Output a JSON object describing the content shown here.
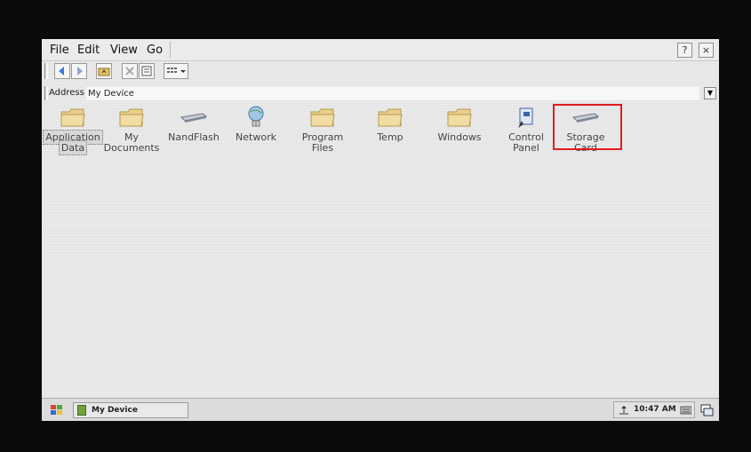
{
  "window": {
    "menu": [
      "File",
      "Edit",
      "View",
      "Go"
    ],
    "help_button": "?",
    "close_button": "×"
  },
  "addressbar": {
    "label": "Address",
    "value": "My Device"
  },
  "icons": [
    {
      "name": "Application Data",
      "line1": "Application",
      "line2": "Data",
      "type": "folder",
      "selected": true
    },
    {
      "name": "My Documents",
      "line1": "My",
      "line2": "Documents",
      "type": "folder"
    },
    {
      "name": "NandFlash",
      "line1": "NandFlash",
      "line2": "",
      "type": "drive"
    },
    {
      "name": "Network",
      "line1": "Network",
      "line2": "",
      "type": "network"
    },
    {
      "name": "Program Files",
      "line1": "Program Files",
      "line2": "",
      "type": "folder"
    },
    {
      "name": "Temp",
      "line1": "Temp",
      "line2": "",
      "type": "folder"
    },
    {
      "name": "Windows",
      "line1": "Windows",
      "line2": "",
      "type": "folder"
    },
    {
      "name": "Control Panel",
      "line1": "Control",
      "line2": "Panel",
      "type": "control-panel"
    },
    {
      "name": "Storage Card",
      "line1": "Storage Card",
      "line2": "",
      "type": "drive",
      "highlighted": true
    }
  ],
  "taskbar": {
    "task_label": "My Device",
    "clock": "10:47 AM"
  },
  "colors": {
    "highlight": "#e21c1c",
    "folder": "#e8cf8c"
  }
}
